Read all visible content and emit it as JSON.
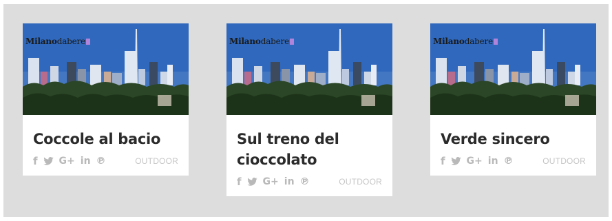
{
  "brand": {
    "name_bold": "Milano",
    "name_regular": "dabere"
  },
  "colors": {
    "background": "#dddddd",
    "card": "#ffffff",
    "title": "#2b2b2b",
    "muted": "#b9b9b9"
  },
  "cards": [
    {
      "title": "Coccole al bacio",
      "category": "OUTDOOR",
      "social": {
        "facebook": "f",
        "twitter": "twitter-icon",
        "googleplus": "G+",
        "linkedin": "in",
        "pinterest": "℗"
      }
    },
    {
      "title": "Sul treno del cioccolato",
      "category": "OUTDOOR",
      "social": {
        "facebook": "f",
        "twitter": "twitter-icon",
        "googleplus": "G+",
        "linkedin": "in",
        "pinterest": "℗"
      }
    },
    {
      "title": "Verde sincero",
      "category": "OUTDOOR",
      "social": {
        "facebook": "f",
        "twitter": "twitter-icon",
        "googleplus": "G+",
        "linkedin": "in",
        "pinterest": "℗"
      }
    }
  ]
}
